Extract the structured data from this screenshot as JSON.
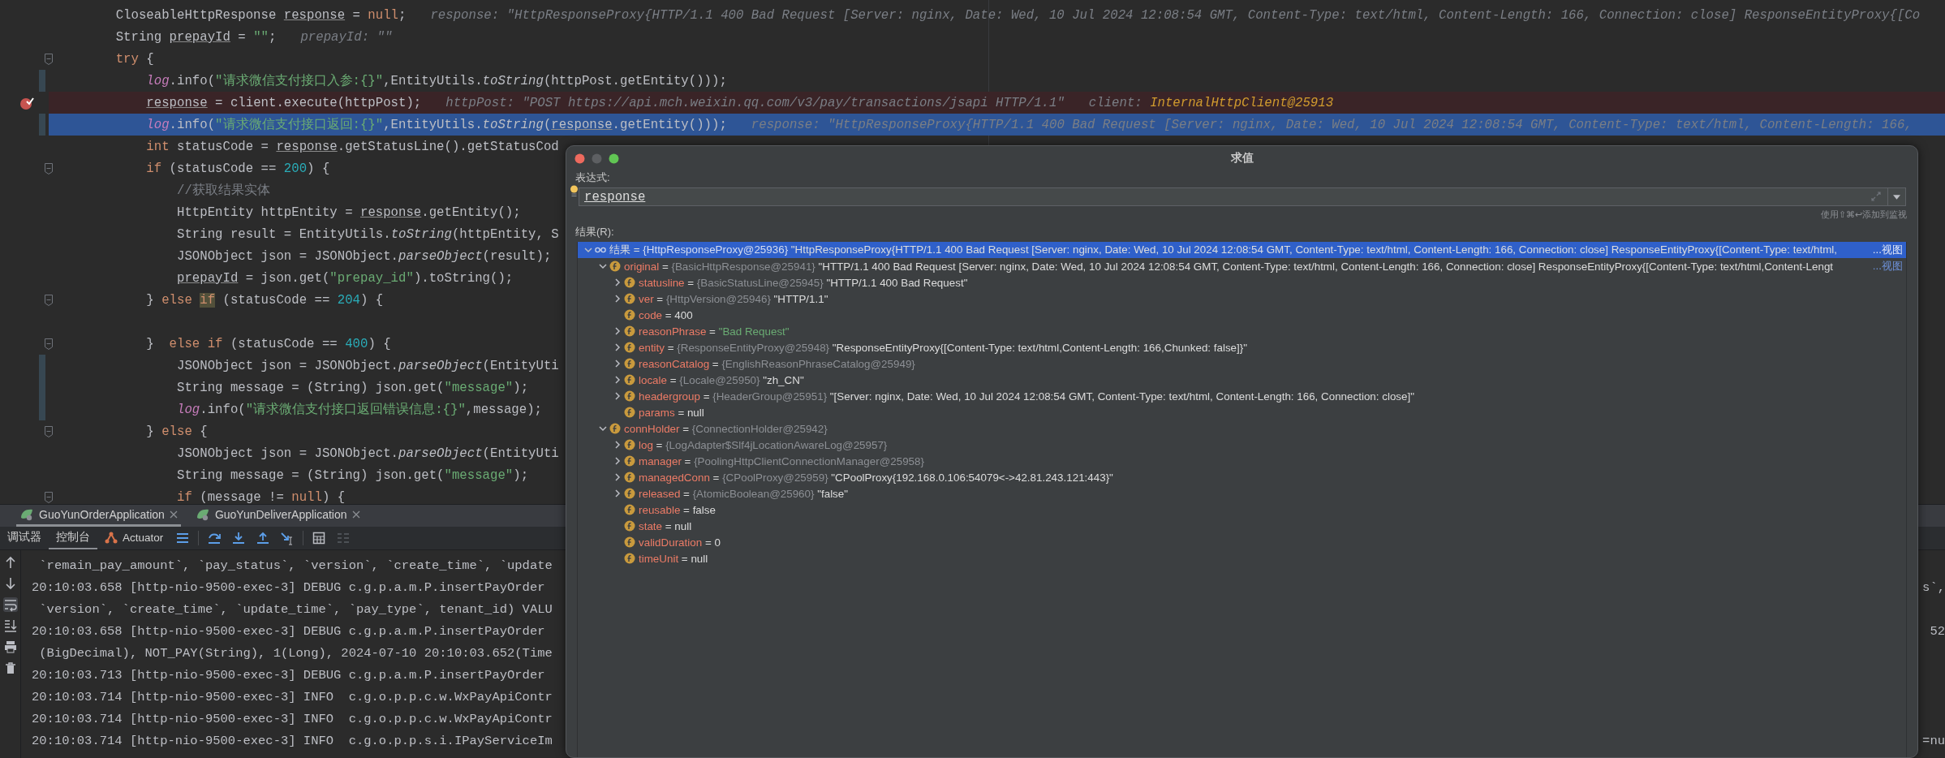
{
  "editor": {
    "lines": [
      {
        "code": [
          {
            "kind": "p",
            "text": "CloseableHttpResponse "
          },
          {
            "kind": "var",
            "text": "response"
          },
          {
            "kind": "p",
            "text": " = "
          },
          {
            "kind": "kw",
            "text": "null"
          },
          {
            "kind": "p",
            "text": ";"
          }
        ],
        "hints": [
          [
            {
              "kind": "h",
              "text": "response: \"HttpResponseProxy{HTTP/1.1 400 Bad Request [Server: nginx, Date: Wed, 10 Jul 2024 12:08:54 GMT, Content-Type: text/html, Content-Length: 166, Connection: close] ResponseEntityProxy{[Co"
            }
          ]
        ],
        "breakpoint": false,
        "current": false,
        "changed": false,
        "foldable": false
      },
      {
        "code": [
          {
            "kind": "p",
            "text": "String "
          },
          {
            "kind": "var",
            "text": "prepayId"
          },
          {
            "kind": "p",
            "text": " = "
          },
          {
            "kind": "str",
            "text": "\"\""
          },
          {
            "kind": "p",
            "text": ";"
          }
        ],
        "hints": [
          [
            {
              "kind": "h",
              "text": "prepayId: \"\""
            }
          ]
        ],
        "breakpoint": false,
        "current": false,
        "changed": false,
        "foldable": false
      },
      {
        "code": [
          {
            "kind": "kw",
            "text": "try"
          },
          {
            "kind": "p",
            "text": " {"
          }
        ],
        "breakpoint": false,
        "current": false,
        "changed": false,
        "foldable": true,
        "children": [
          {
            "code": [
              {
                "kind": "st",
                "text": "log"
              },
              {
                "kind": "p",
                "text": ".info("
              },
              {
                "kind": "str",
                "text": "\"请求微信支付接口入参:{}\""
              },
              {
                "kind": "p",
                "text": ",EntityUtils."
              },
              {
                "kind": "it",
                "text": "toString"
              },
              {
                "kind": "p",
                "text": "(httpPost.getEntity()));"
              }
            ],
            "breakpoint": false,
            "current": false,
            "changed": true,
            "foldable": false
          },
          {
            "code": [
              {
                "kind": "var",
                "text": "response"
              },
              {
                "kind": "p",
                "text": " = client.execute(httpPost);"
              }
            ],
            "hints": [
              [
                {
                  "kind": "h",
                  "text": "httpPost: \"POST https://api.mch.weixin.qq.com/v3/pay/transactions/jsapi HTTP/1.1\""
                }
              ],
              [
                {
                  "kind": "h",
                  "text": "client: "
                },
                {
                  "kind": "hv",
                  "text": "InternalHttpClient@25913"
                }
              ]
            ],
            "breakpoint": true,
            "current": false,
            "changed": false,
            "foldable": false
          },
          {
            "code": [
              {
                "kind": "st",
                "text": "log"
              },
              {
                "kind": "p",
                "text": ".info("
              },
              {
                "kind": "str",
                "text": "\"请求微信支付接口返回:{}\""
              },
              {
                "kind": "p",
                "text": ",EntityUtils."
              },
              {
                "kind": "it",
                "text": "toString"
              },
              {
                "kind": "p",
                "text": "("
              },
              {
                "kind": "var",
                "text": "response"
              },
              {
                "kind": "p",
                "text": ".getEntity()));"
              }
            ],
            "hints": [
              [
                {
                  "kind": "h",
                  "text": "response: \"HttpResponseProxy{HTTP/1.1 400 Bad Request [Server: nginx, Date: Wed, 10 Jul 2024 12:08:54 GMT, Content-Type: text/html, Content-Length: 166,"
                }
              ]
            ],
            "breakpoint": false,
            "current": true,
            "changed": true,
            "foldable": false
          },
          {
            "code": [
              {
                "kind": "kw",
                "text": "int"
              },
              {
                "kind": "p",
                "text": " statusCode = "
              },
              {
                "kind": "var",
                "text": "response"
              },
              {
                "kind": "p",
                "text": ".getStatusLine().getStatusCod"
              }
            ],
            "breakpoint": false,
            "current": false,
            "changed": false,
            "foldable": false
          },
          {
            "code": [
              {
                "kind": "kw",
                "text": "if"
              },
              {
                "kind": "p",
                "text": " (statusCode == "
              },
              {
                "kind": "num",
                "text": "200"
              },
              {
                "kind": "p",
                "text": ") {"
              }
            ],
            "breakpoint": false,
            "current": false,
            "changed": false,
            "foldable": true,
            "children": [
              {
                "code": [
                  {
                    "kind": "cm",
                    "text": "//获取结果实体"
                  }
                ],
                "breakpoint": false,
                "current": false,
                "changed": false,
                "foldable": false
              },
              {
                "code": [
                  {
                    "kind": "p",
                    "text": "HttpEntity httpEntity = "
                  },
                  {
                    "kind": "var",
                    "text": "response"
                  },
                  {
                    "kind": "p",
                    "text": ".getEntity();"
                  }
                ],
                "breakpoint": false,
                "current": false,
                "changed": false,
                "foldable": false
              },
              {
                "code": [
                  {
                    "kind": "p",
                    "text": "String result = EntityUtils."
                  },
                  {
                    "kind": "it",
                    "text": "toString"
                  },
                  {
                    "kind": "p",
                    "text": "(httpEntity, S"
                  }
                ],
                "breakpoint": false,
                "current": false,
                "changed": false,
                "foldable": false
              },
              {
                "code": [
                  {
                    "kind": "p",
                    "text": "JSONObject json = JSONObject."
                  },
                  {
                    "kind": "it",
                    "text": "parseObject"
                  },
                  {
                    "kind": "p",
                    "text": "(result);"
                  }
                ],
                "breakpoint": false,
                "current": false,
                "changed": false,
                "foldable": false
              },
              {
                "code": [
                  {
                    "kind": "var",
                    "text": "prepayId"
                  },
                  {
                    "kind": "p",
                    "text": " = json.get("
                  },
                  {
                    "kind": "str",
                    "text": "\"prepay_id\""
                  },
                  {
                    "kind": "p",
                    "text": ").toString();"
                  }
                ],
                "breakpoint": false,
                "current": false,
                "changed": false,
                "foldable": false
              }
            ]
          },
          {
            "code": [
              {
                "kind": "p",
                "text": "} "
              },
              {
                "kind": "kw",
                "text": "else "
              },
              {
                "kind": "kwhl",
                "text": "if"
              },
              {
                "kind": "p",
                "text": " (statusCode == "
              },
              {
                "kind": "num",
                "text": "204"
              },
              {
                "kind": "p",
                "text": ") {"
              }
            ],
            "breakpoint": false,
            "current": false,
            "changed": false,
            "foldable": true,
            "children": [
              {
                "breakpoint": false,
                "current": false,
                "changed": false,
                "foldable": false
              }
            ]
          },
          {
            "code": [
              {
                "kind": "p",
                "text": "}  "
              },
              {
                "kind": "kw",
                "text": "else if"
              },
              {
                "kind": "p",
                "text": " (statusCode == "
              },
              {
                "kind": "num",
                "text": "400"
              },
              {
                "kind": "p",
                "text": ") {"
              }
            ],
            "breakpoint": false,
            "current": false,
            "changed": false,
            "foldable": true,
            "children": [
              {
                "code": [
                  {
                    "kind": "p",
                    "text": "JSONObject json = JSONObject."
                  },
                  {
                    "kind": "it",
                    "text": "parseObject"
                  },
                  {
                    "kind": "p",
                    "text": "(EntityUti"
                  }
                ],
                "breakpoint": false,
                "current": false,
                "changed": true,
                "foldable": false
              },
              {
                "code": [
                  {
                    "kind": "p",
                    "text": "String message = (String) json.get("
                  },
                  {
                    "kind": "str",
                    "text": "\"message\""
                  },
                  {
                    "kind": "p",
                    "text": ");"
                  }
                ],
                "breakpoint": false,
                "current": false,
                "changed": true,
                "foldable": false
              },
              {
                "code": [
                  {
                    "kind": "st",
                    "text": "log"
                  },
                  {
                    "kind": "p",
                    "text": ".info("
                  },
                  {
                    "kind": "str",
                    "text": "\"请求微信支付接口返回错误信息:{}\""
                  },
                  {
                    "kind": "p",
                    "text": ",message);"
                  }
                ],
                "breakpoint": false,
                "current": false,
                "changed": true,
                "foldable": false
              }
            ]
          },
          {
            "code": [
              {
                "kind": "p",
                "text": "} "
              },
              {
                "kind": "kw",
                "text": "else"
              },
              {
                "kind": "p",
                "text": " {"
              }
            ],
            "breakpoint": false,
            "current": false,
            "changed": false,
            "foldable": true,
            "children": [
              {
                "code": [
                  {
                    "kind": "p",
                    "text": "JSONObject json = JSONObject."
                  },
                  {
                    "kind": "it",
                    "text": "parseObject"
                  },
                  {
                    "kind": "p",
                    "text": "(EntityUti"
                  }
                ],
                "breakpoint": false,
                "current": false,
                "changed": false,
                "foldable": false
              },
              {
                "code": [
                  {
                    "kind": "p",
                    "text": "String message = (String) json.get("
                  },
                  {
                    "kind": "str",
                    "text": "\"message\""
                  },
                  {
                    "kind": "p",
                    "text": ");"
                  }
                ],
                "breakpoint": false,
                "current": false,
                "changed": false,
                "foldable": false
              },
              {
                "code": [
                  {
                    "kind": "kw",
                    "text": "if"
                  },
                  {
                    "kind": "p",
                    "text": " (message != "
                  },
                  {
                    "kind": "kw",
                    "text": "null"
                  },
                  {
                    "kind": "p",
                    "text": ") {"
                  }
                ],
                "breakpoint": false,
                "current": false,
                "changed": false,
                "foldable": true
              }
            ]
          }
        ]
      }
    ]
  },
  "debug_panel": {
    "sessions": [
      {
        "label": "GuoYunOrderApplication",
        "selected": true
      },
      {
        "label": "GuoYunDeliverApplication",
        "selected": false
      }
    ],
    "tabs": [
      {
        "label": "调试器",
        "selected": false,
        "kind": "text"
      },
      {
        "label": "控制台",
        "selected": true,
        "kind": "text"
      },
      {
        "label": "Actuator",
        "selected": false,
        "kind": "actuator"
      }
    ],
    "console": {
      "soft_wrap": true,
      "lines": [
        {
          "text": " `remain_pay_amount`, `pay_status`, `version`, `create_time`, `update"
        },
        {
          "text": "20:10:03.658 [http-nio-9500-exec-3] DEBUG c.g.p.a.m.P.insertPayOrder",
          "tail": "s`,"
        },
        {
          "text": " `version`, `create_time`, `update_time`, `pay_type`, tenant_id) VALU"
        },
        {
          "text": "20:10:03.658 [http-nio-9500-exec-3] DEBUG c.g.p.a.m.P.insertPayOrder",
          "tail": "52"
        },
        {
          "text": " (BigDecimal), NOT_PAY(String), 1(Long), 2024-07-10 20:10:03.652(Time"
        },
        {
          "text": "20:10:03.713 [http-nio-9500-exec-3] DEBUG c.g.p.a.m.P.insertPayOrder"
        },
        {
          "text": "20:10:03.714 [http-nio-9500-exec-3] INFO  c.g.o.p.p.c.w.WxPayApiContr"
        },
        {
          "text": "20:10:03.714 [http-nio-9500-exec-3] INFO  c.g.o.p.p.c.w.WxPayApiContr"
        },
        {
          "text": "20:10:03.714 [http-nio-9500-exec-3] INFO  c.g.o.p.p.s.i.IPayServiceIm",
          "tail": "=nu"
        }
      ]
    }
  },
  "dialog": {
    "title": "求值",
    "expression_label": "表达式:",
    "expression": "response",
    "watch_hint": "使用⇧⌘↩添加到监视",
    "result_label": "结果(R):",
    "tree": [
      {
        "kind": "watch",
        "selected": true,
        "expanded": true,
        "label": [
          {
            "kind": "root",
            "text": "结果"
          },
          {
            "kind": "p",
            "text": " = "
          },
          {
            "kind": "type",
            "text": "{HttpResponseProxy@25936}"
          },
          {
            "kind": "p",
            "text": " \"HttpResponseProxy{HTTP/1.1 400 Bad Request [Server: nginx, Date: Wed, 10 Jul 2024 12:08:54 GMT, Content-Type: text/html, Content-Length: 166, Connection: close] ResponseEntityProxy{[Content-Type: text/html,"
          }
        ],
        "link": "...视图",
        "children": [
          {
            "kind": "field",
            "selected": false,
            "expanded": true,
            "label": [
              {
                "kind": "name",
                "text": "original"
              },
              {
                "kind": "p",
                "text": " = "
              },
              {
                "kind": "type",
                "text": "{BasicHttpResponse@25941}"
              },
              {
                "kind": "p",
                "text": " \"HTTP/1.1 400 Bad Request [Server: nginx, Date: Wed, 10 Jul 2024 12:08:54 GMT, Content-Type: text/html, Content-Length: 166, Connection: close] ResponseEntityProxy{[Content-Type: text/html,Content-Lengt"
              }
            ],
            "link": "...视图",
            "children": [
              {
                "kind": "field",
                "selected": false,
                "expanded": false,
                "label": [
                  {
                    "kind": "name",
                    "text": "statusline"
                  },
                  {
                    "kind": "p",
                    "text": " = "
                  },
                  {
                    "kind": "type",
                    "text": "{BasicStatusLine@25945}"
                  },
                  {
                    "kind": "p",
                    "text": " \"HTTP/1.1 400 Bad Request\""
                  }
                ]
              },
              {
                "kind": "field",
                "selected": false,
                "expanded": false,
                "label": [
                  {
                    "kind": "name",
                    "text": "ver"
                  },
                  {
                    "kind": "p",
                    "text": " = "
                  },
                  {
                    "kind": "type",
                    "text": "{HttpVersion@25946}"
                  },
                  {
                    "kind": "p",
                    "text": " \"HTTP/1.1\""
                  }
                ]
              },
              {
                "kind": "field",
                "selected": false,
                "label": [
                  {
                    "kind": "name",
                    "text": "code"
                  },
                  {
                    "kind": "p",
                    "text": " = 400"
                  }
                ]
              },
              {
                "kind": "field",
                "selected": false,
                "expanded": false,
                "label": [
                  {
                    "kind": "name",
                    "text": "reasonPhrase"
                  },
                  {
                    "kind": "p",
                    "text": " = "
                  },
                  {
                    "kind": "str",
                    "text": "\"Bad Request\""
                  }
                ]
              },
              {
                "kind": "field",
                "selected": false,
                "expanded": false,
                "label": [
                  {
                    "kind": "name",
                    "text": "entity"
                  },
                  {
                    "kind": "p",
                    "text": " = "
                  },
                  {
                    "kind": "type",
                    "text": "{ResponseEntityProxy@25948}"
                  },
                  {
                    "kind": "p",
                    "text": " \"ResponseEntityProxy{[Content-Type: text/html,Content-Length: 166,Chunked: false]}\""
                  }
                ]
              },
              {
                "kind": "field",
                "selected": false,
                "expanded": false,
                "label": [
                  {
                    "kind": "name",
                    "text": "reasonCatalog"
                  },
                  {
                    "kind": "p",
                    "text": " = "
                  },
                  {
                    "kind": "type",
                    "text": "{EnglishReasonPhraseCatalog@25949}"
                  }
                ]
              },
              {
                "kind": "field",
                "selected": false,
                "expanded": false,
                "label": [
                  {
                    "kind": "name",
                    "text": "locale"
                  },
                  {
                    "kind": "p",
                    "text": " = "
                  },
                  {
                    "kind": "type",
                    "text": "{Locale@25950}"
                  },
                  {
                    "kind": "p",
                    "text": " \"zh_CN\""
                  }
                ]
              },
              {
                "kind": "field",
                "selected": false,
                "expanded": false,
                "label": [
                  {
                    "kind": "name",
                    "text": "headergroup"
                  },
                  {
                    "kind": "p",
                    "text": " = "
                  },
                  {
                    "kind": "type",
                    "text": "{HeaderGroup@25951}"
                  },
                  {
                    "kind": "p",
                    "text": " \"[Server: nginx, Date: Wed, 10 Jul 2024 12:08:54 GMT, Content-Type: text/html, Content-Length: 166, Connection: close]\""
                  }
                ]
              },
              {
                "kind": "field",
                "selected": false,
                "label": [
                  {
                    "kind": "name",
                    "text": "params"
                  },
                  {
                    "kind": "p",
                    "text": " = null"
                  }
                ]
              }
            ]
          },
          {
            "kind": "field",
            "selected": false,
            "expanded": true,
            "label": [
              {
                "kind": "name",
                "text": "connHolder"
              },
              {
                "kind": "p",
                "text": " = "
              },
              {
                "kind": "type",
                "text": "{ConnectionHolder@25942}"
              }
            ],
            "children": [
              {
                "kind": "field",
                "selected": false,
                "expanded": false,
                "label": [
                  {
                    "kind": "name",
                    "text": "log"
                  },
                  {
                    "kind": "p",
                    "text": " = "
                  },
                  {
                    "kind": "type",
                    "text": "{LogAdapter$Slf4jLocationAwareLog@25957}"
                  }
                ]
              },
              {
                "kind": "field",
                "selected": false,
                "expanded": false,
                "label": [
                  {
                    "kind": "name",
                    "text": "manager"
                  },
                  {
                    "kind": "p",
                    "text": " = "
                  },
                  {
                    "kind": "type",
                    "text": "{PoolingHttpClientConnectionManager@25958}"
                  }
                ]
              },
              {
                "kind": "field",
                "selected": false,
                "expanded": false,
                "label": [
                  {
                    "kind": "name",
                    "text": "managedConn"
                  },
                  {
                    "kind": "p",
                    "text": " = "
                  },
                  {
                    "kind": "type",
                    "text": "{CPoolProxy@25959}"
                  },
                  {
                    "kind": "p",
                    "text": " \"CPoolProxy{192.168.0.106:54079<->42.81.243.121:443}\""
                  }
                ]
              },
              {
                "kind": "field",
                "selected": false,
                "expanded": false,
                "label": [
                  {
                    "kind": "name",
                    "text": "released"
                  },
                  {
                    "kind": "p",
                    "text": " = "
                  },
                  {
                    "kind": "type",
                    "text": "{AtomicBoolean@25960}"
                  },
                  {
                    "kind": "p",
                    "text": " \"false\""
                  }
                ]
              },
              {
                "kind": "field",
                "selected": false,
                "label": [
                  {
                    "kind": "name",
                    "text": "reusable"
                  },
                  {
                    "kind": "p",
                    "text": " = false"
                  }
                ]
              },
              {
                "kind": "field",
                "selected": false,
                "label": [
                  {
                    "kind": "name",
                    "text": "state"
                  },
                  {
                    "kind": "p",
                    "text": " = null"
                  }
                ]
              },
              {
                "kind": "field",
                "selected": false,
                "label": [
                  {
                    "kind": "name",
                    "text": "validDuration"
                  },
                  {
                    "kind": "p",
                    "text": " = 0"
                  }
                ]
              },
              {
                "kind": "field",
                "selected": false,
                "label": [
                  {
                    "kind": "name",
                    "text": "timeUnit"
                  },
                  {
                    "kind": "p",
                    "text": " = null"
                  }
                ]
              }
            ]
          }
        ]
      }
    ]
  }
}
